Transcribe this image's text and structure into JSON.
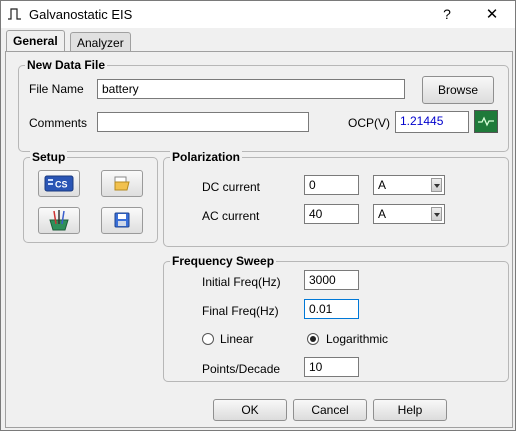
{
  "window": {
    "title": "Galvanostatic EIS",
    "help_glyph": "?",
    "close_glyph": "✕"
  },
  "tabs": [
    {
      "label": "General",
      "active": true
    },
    {
      "label": "Analyzer",
      "active": false
    }
  ],
  "new_data_file": {
    "group_label": "New Data File",
    "file_name_label": "File Name",
    "file_name_value": "battery",
    "browse_label": "Browse",
    "comments_label": "Comments",
    "comments_value": "",
    "ocp_label": "OCP(V)",
    "ocp_value": "1.21445",
    "ocp_value_color": "#0000cc",
    "ocp_icon": "waveform-icon"
  },
  "setup": {
    "group_label": "Setup",
    "buttons": [
      {
        "icon": "cs-device-icon"
      },
      {
        "icon": "open-folder-icon"
      },
      {
        "icon": "cell-electrodes-icon"
      },
      {
        "icon": "save-disk-icon"
      }
    ]
  },
  "polarization": {
    "group_label": "Polarization",
    "dc_label": "DC current",
    "dc_value": "0",
    "dc_unit": "A",
    "ac_label": "AC current",
    "ac_value": "40",
    "ac_unit": "A"
  },
  "frequency_sweep": {
    "group_label": "Frequency Sweep",
    "initial_label": "Initial Freq(Hz)",
    "initial_value": "3000",
    "final_label": "Final Freq(Hz)",
    "final_value": "0.01",
    "linear_label": "Linear",
    "log_label": "Logarithmic",
    "selected_mode": "Logarithmic",
    "points_label": "Points/Decade",
    "points_value": "10"
  },
  "footer": {
    "ok_label": "OK",
    "cancel_label": "Cancel",
    "help_label": "Help"
  },
  "colors": {
    "accent_focus": "#0078d7",
    "ocp_icon_bg": "#1f7a3a"
  }
}
